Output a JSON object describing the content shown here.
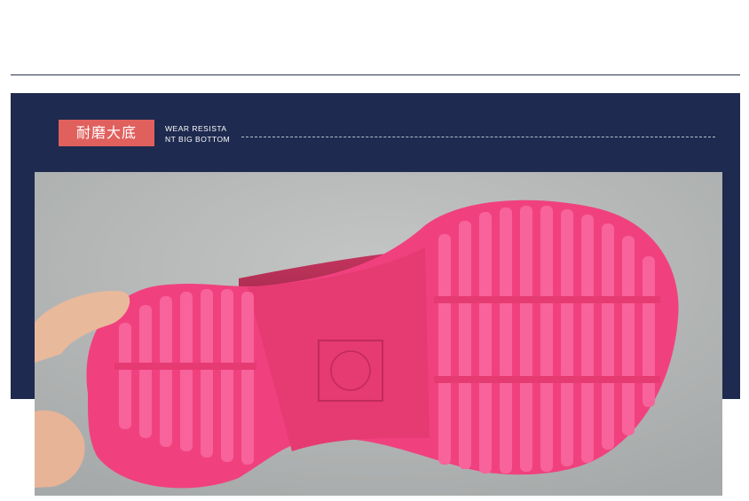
{
  "header": {
    "badge_label": "耐磨大底",
    "subtitle_line1": "WEAR RESISTA",
    "subtitle_line2": "NT BIG BOTTOM"
  },
  "colors": {
    "navy_band": "#1e2a4f",
    "badge_red": "#e0605e",
    "sole_pink": "#f0417e",
    "background_grey": "#b5b8b8"
  },
  "photo": {
    "subject": "pink-rubber-shoe-sole"
  }
}
